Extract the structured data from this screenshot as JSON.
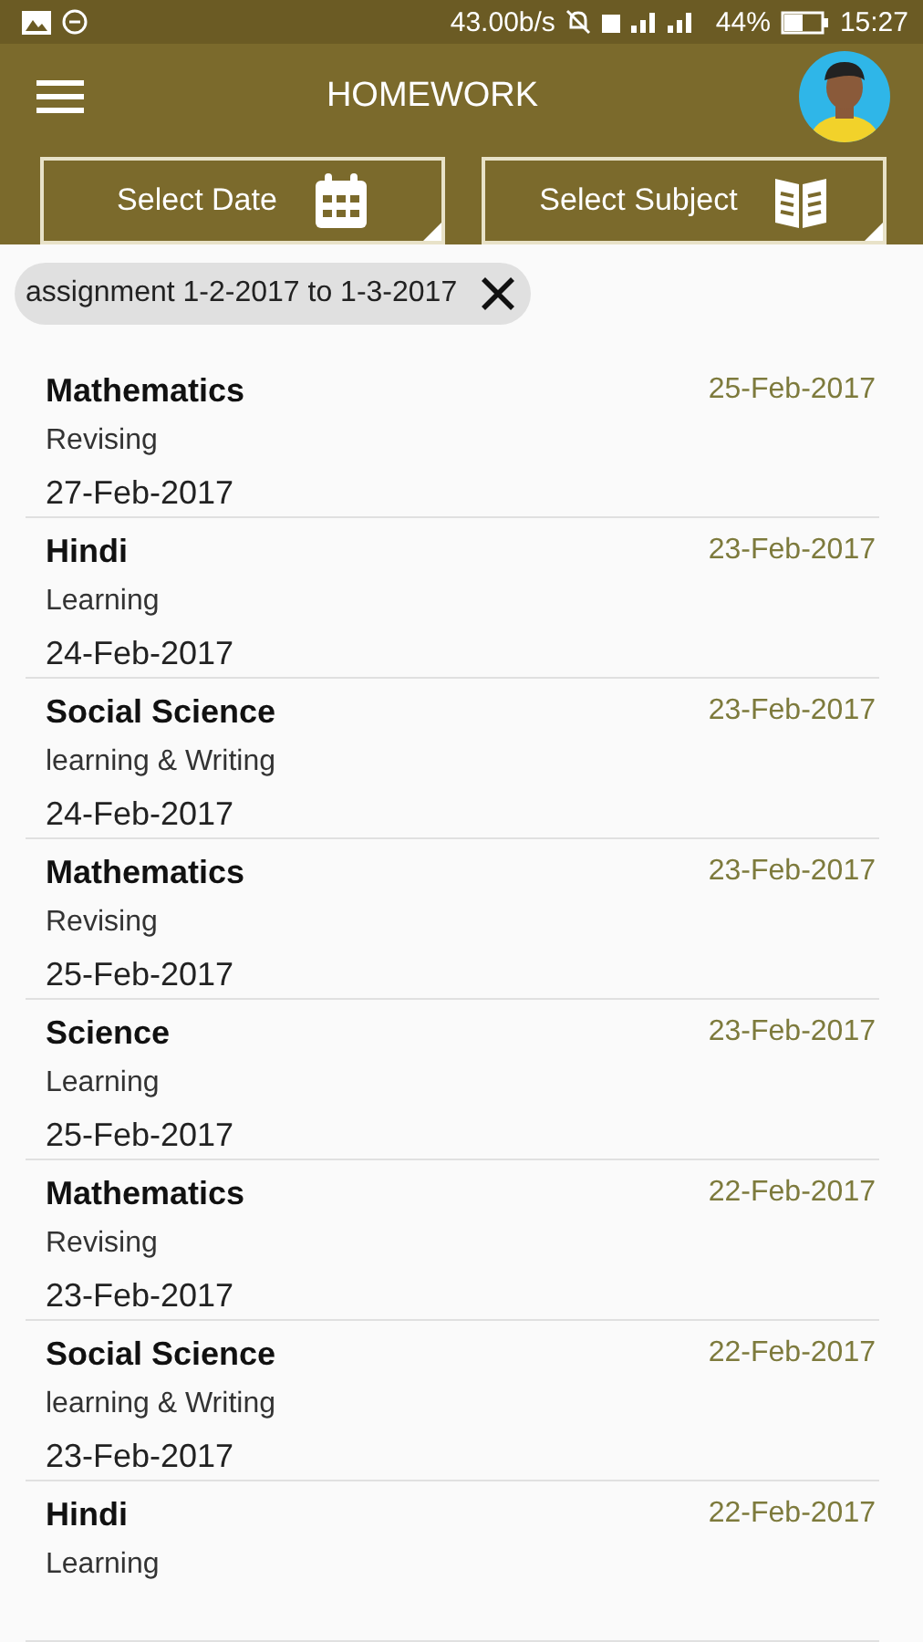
{
  "status_bar": {
    "speed": "43.00b/s",
    "battery": "44%",
    "time": "15:27"
  },
  "header": {
    "title": "HOMEWORK"
  },
  "filters": [
    {
      "label": "Select Date",
      "kind": "date"
    },
    {
      "label": "Select Subject",
      "kind": "subject"
    }
  ],
  "chip": {
    "label": "assignment 1-2-2017 to 1-3-2017"
  },
  "items": [
    {
      "subject": "Mathematics",
      "task": "Revising",
      "due": "27-Feb-2017",
      "assigned": "25-Feb-2017"
    },
    {
      "subject": "Hindi",
      "task": "Learning",
      "due": "24-Feb-2017",
      "assigned": "23-Feb-2017"
    },
    {
      "subject": "Social Science",
      "task": "learning & Writing",
      "due": "24-Feb-2017",
      "assigned": "23-Feb-2017"
    },
    {
      "subject": "Mathematics",
      "task": "Revising",
      "due": "25-Feb-2017",
      "assigned": "23-Feb-2017"
    },
    {
      "subject": "Science",
      "task": "Learning",
      "due": "25-Feb-2017",
      "assigned": "23-Feb-2017"
    },
    {
      "subject": "Mathematics",
      "task": "Revising",
      "due": "23-Feb-2017",
      "assigned": "22-Feb-2017"
    },
    {
      "subject": "Social Science",
      "task": "learning & Writing",
      "due": "23-Feb-2017",
      "assigned": "22-Feb-2017"
    },
    {
      "subject": "Hindi",
      "task": "Learning",
      "assigned": "22-Feb-2017"
    }
  ]
}
